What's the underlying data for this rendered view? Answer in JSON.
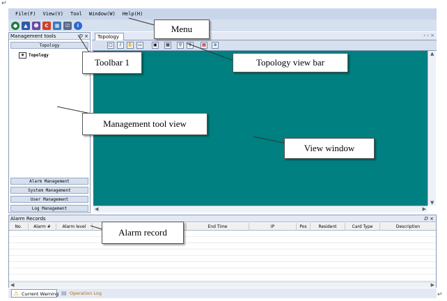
{
  "menu": {
    "items": [
      "File(F)",
      "View(V)",
      "Tool",
      "Window(W)",
      "Help(H)"
    ]
  },
  "toolbar1": {
    "buttons": [
      "globe-icon",
      "chart-icon",
      "user-icon",
      "refresh-icon",
      "network-icon",
      "clipboard-icon",
      "info-icon"
    ]
  },
  "management_tools": {
    "title": "Management tools",
    "controls": "ⅅ ×",
    "top_button": "Topology",
    "tree_item": "Topology",
    "bottom_buttons": [
      "Alarm Management",
      "System Management",
      "User Management",
      "Log Management"
    ]
  },
  "topology": {
    "tab_label": "Topology",
    "tab_nav": "‹ › ×",
    "bar_buttons": [
      "select-icon",
      "line-icon",
      "pan-icon",
      "rect-icon",
      "save-icon",
      "grid-icon",
      "zoom-in-icon",
      "zoom-out-icon",
      "layout-icon",
      "globe-icon"
    ]
  },
  "alarm_records": {
    "title": "Alarm Records",
    "controls": "ⅅ ×",
    "columns": [
      "No.",
      "Alarm #",
      "Alarm level",
      "",
      "End Time",
      "IP",
      "Pos",
      "Resident",
      "Card Type",
      "Description"
    ]
  },
  "bottom_tabs": [
    "Current Warning",
    "Operation Log"
  ],
  "callouts": {
    "menu": "Menu",
    "toolbar": "Toolbar 1",
    "topology_bar": "Topology view bar",
    "management_view": "Management tool view",
    "view_window": "View window",
    "alarm_record": "Alarm record"
  },
  "colors": {
    "view_window": "#008080",
    "menubar": "#c9d6ea"
  }
}
